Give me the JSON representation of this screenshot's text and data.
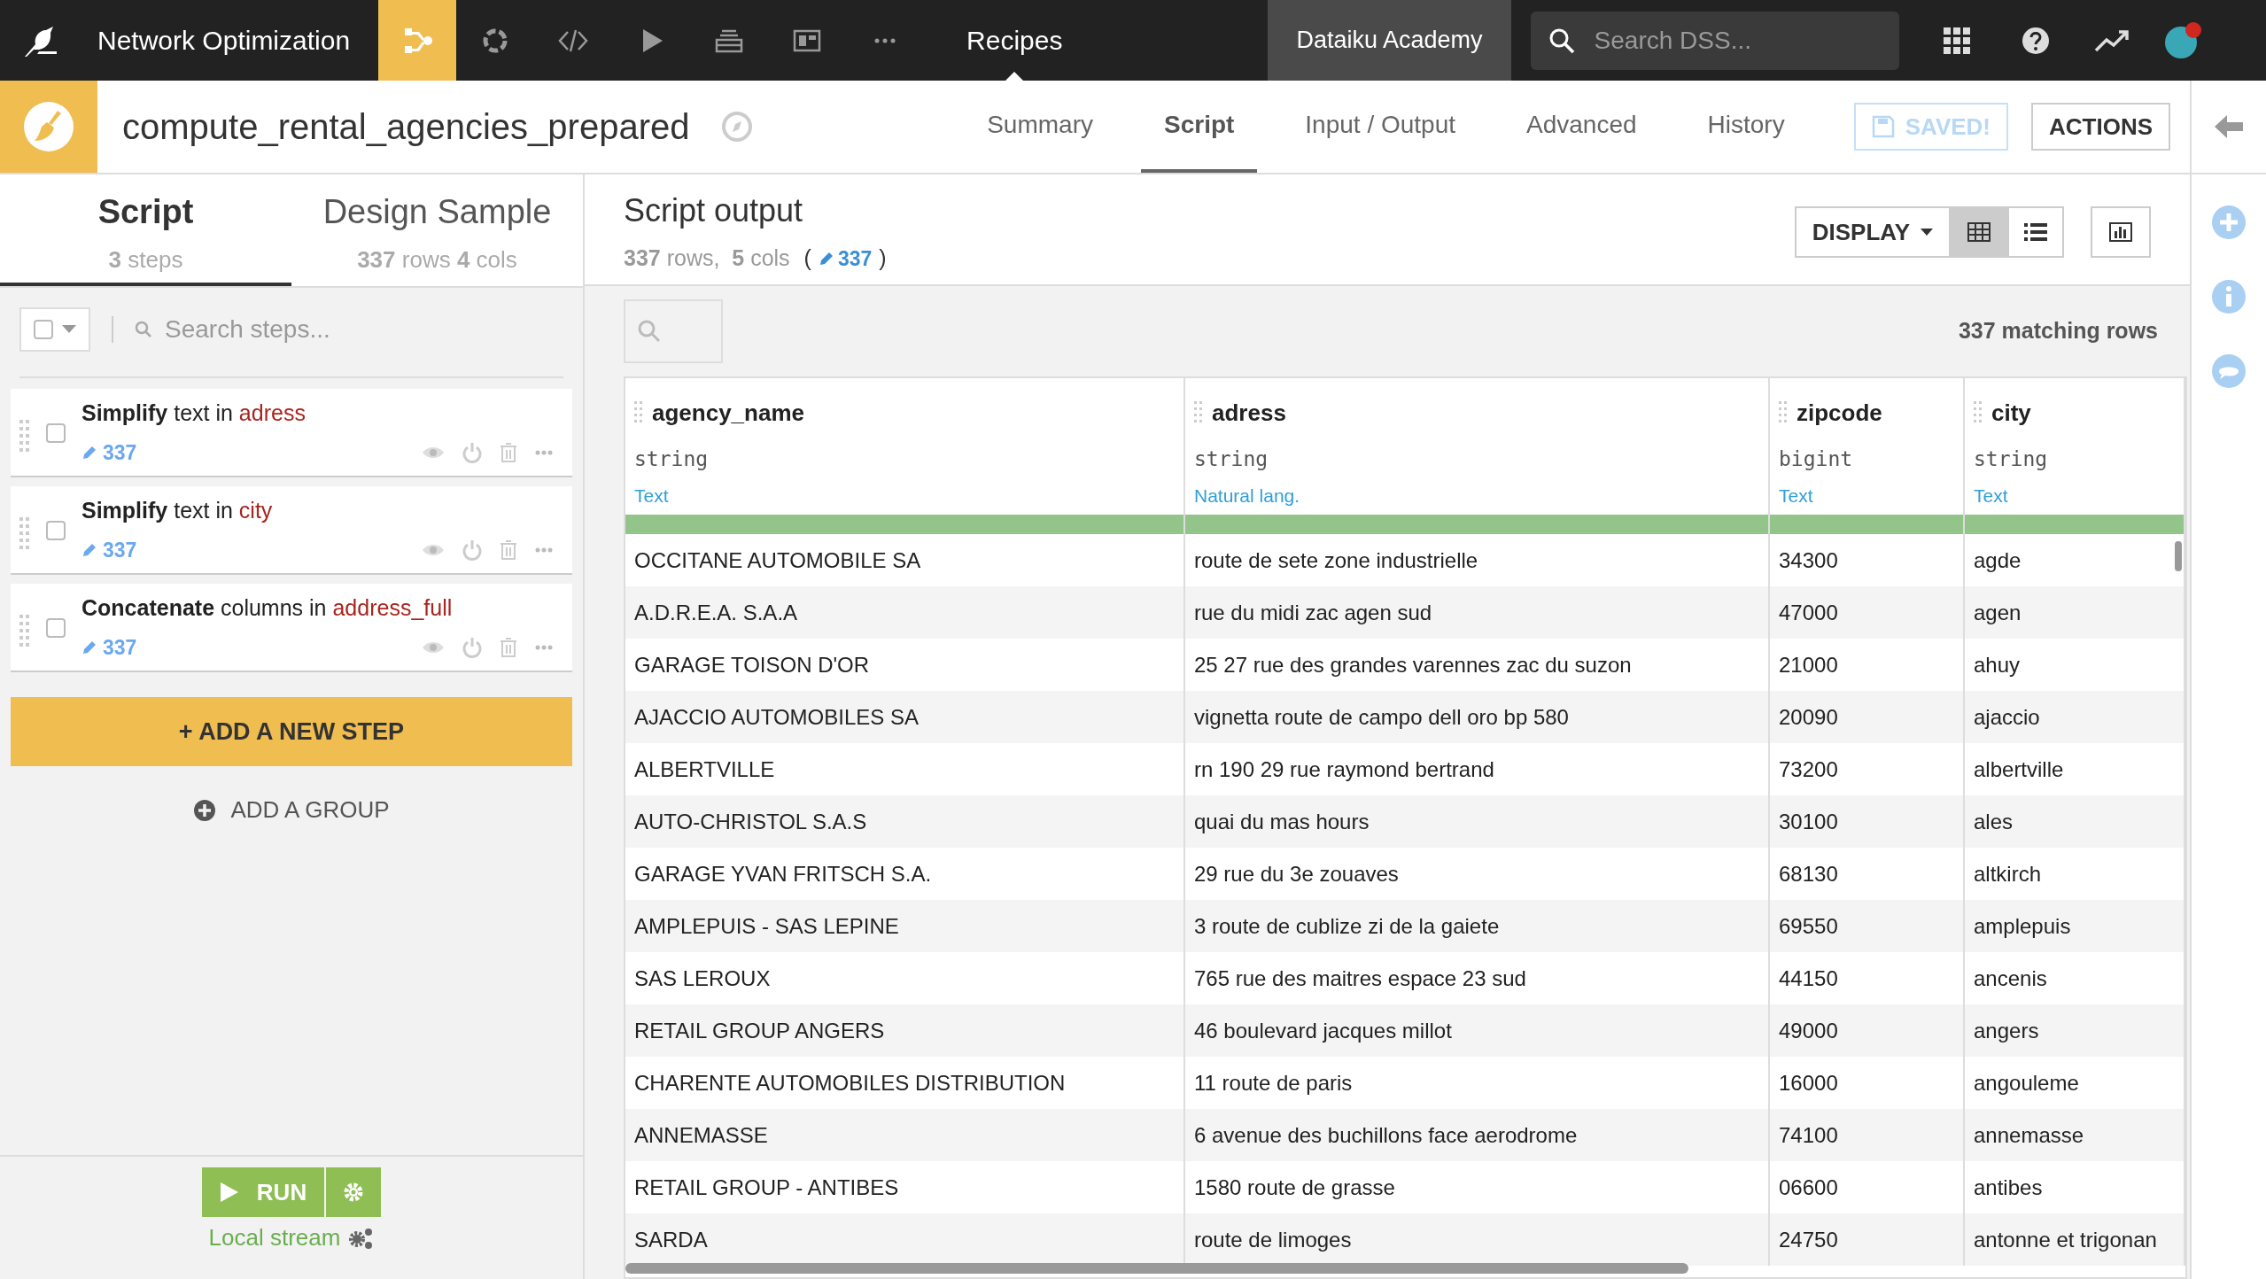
{
  "top_bar": {
    "project": "Network Optimization",
    "nav": [
      {
        "kind": "flow",
        "selected": true
      },
      {
        "kind": "cycle",
        "selected": false
      },
      {
        "kind": "code",
        "selected": false
      },
      {
        "kind": "play",
        "selected": false
      },
      {
        "kind": "stack",
        "selected": false
      },
      {
        "kind": "dashboard",
        "selected": false
      },
      {
        "kind": "more",
        "selected": false
      }
    ],
    "section": "Recipes",
    "workspace": "Dataiku Academy",
    "search": {
      "placeholder": "Search DSS..."
    }
  },
  "recipe": {
    "name": "compute_rental_agencies_prepared",
    "tabs": [
      {
        "label": "Summary",
        "selected": false
      },
      {
        "label": "Script",
        "selected": true
      },
      {
        "label": "Input / Output",
        "selected": false
      },
      {
        "label": "Advanced",
        "selected": false
      },
      {
        "label": "History",
        "selected": false
      }
    ],
    "saved": "SAVED!",
    "actions": "ACTIONS"
  },
  "left_panel": {
    "tabs": [
      {
        "label": "Script",
        "sub": "**3** steps",
        "selected": true
      },
      {
        "label": "Design Sample",
        "sub": "**337** rows **4** cols",
        "selected": false
      }
    ],
    "search": {
      "placeholder": "Search steps..."
    },
    "steps": [
      {
        "title": "**Simplify** text in",
        "column": "adress",
        "count": "337",
        "checked": false
      },
      {
        "title": "**Simplify** text in",
        "column": "city",
        "count": "337",
        "checked": false
      },
      {
        "title": "**Concatenate** columns in",
        "column": "address_full",
        "count": "337",
        "checked": false
      }
    ],
    "add_step": "+ ADD A NEW STEP",
    "add_group": "ADD A GROUP",
    "run": "RUN",
    "engine": "Local stream"
  },
  "output": {
    "title": "Script output",
    "summary": "**337** rows,  **5** cols",
    "paren_open": "(",
    "count": "337",
    "paren_close": ")",
    "display": "DISPLAY",
    "matching": "337 matching rows",
    "columns": [
      {
        "name": "agency_name",
        "type": "string",
        "meaning": "Text",
        "level": 1
      },
      {
        "name": "adress",
        "type": "string",
        "meaning": "Natural lang.",
        "level": 1
      },
      {
        "name": "zipcode",
        "type": "bigint",
        "meaning": "Text",
        "level": 1
      },
      {
        "name": "city",
        "type": "string",
        "meaning": "Text",
        "level": 1
      }
    ],
    "rows": [
      [
        "OCCITANE AUTOMOBILE SA",
        "route de sete zone industrielle",
        "34300",
        "agde"
      ],
      [
        "A.D.R.E.A. S.A.A",
        "rue du midi zac agen sud",
        "47000",
        "agen"
      ],
      [
        "GARAGE TOISON D'OR",
        "25 27 rue des grandes varennes zac du suzon",
        "21000",
        "ahuy"
      ],
      [
        "AJACCIO AUTOMOBILES SA",
        "vignetta route de campo dell oro bp 580",
        "20090",
        "ajaccio"
      ],
      [
        "ALBERTVILLE",
        "rn 190 29 rue raymond bertrand",
        "73200",
        "albertville"
      ],
      [
        "AUTO-CHRISTOL S.A.S",
        "quai du mas hours",
        "30100",
        "ales"
      ],
      [
        "GARAGE YVAN FRITSCH S.A.",
        "29 rue du 3e zouaves",
        "68130",
        "altkirch"
      ],
      [
        "AMPLEPUIS - SAS LEPINE",
        "3 route de cublize zi de la gaiete",
        "69550",
        "amplepuis"
      ],
      [
        "SAS LEROUX",
        "765 rue des maitres espace 23 sud",
        "44150",
        "ancenis"
      ],
      [
        "RETAIL GROUP ANGERS",
        "46 boulevard jacques millot",
        "49000",
        "angers"
      ],
      [
        "CHARENTE AUTOMOBILES DISTRIBUTION",
        "11 route de paris",
        "16000",
        "angouleme"
      ],
      [
        "ANNEMASSE",
        "6 avenue des buchillons face aerodrome",
        "74100",
        "annemasse"
      ],
      [
        "RETAIL GROUP - ANTIBES",
        "1580 route de grasse",
        "06600",
        "antibes"
      ],
      [
        "SARDA",
        "route de limoges",
        "24750",
        "antonne et trigonan"
      ]
    ]
  }
}
